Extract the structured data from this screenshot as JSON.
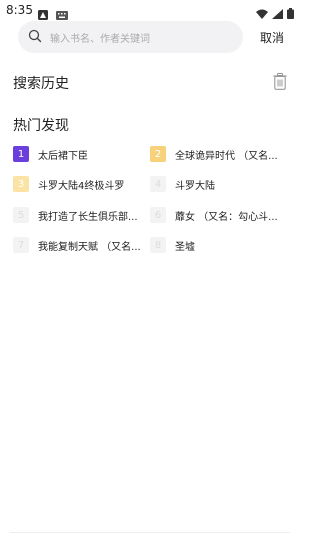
{
  "status_bar": {
    "time": "8:35"
  },
  "search": {
    "placeholder": "输入书名、作者关键词",
    "cancel_label": "取消"
  },
  "history": {
    "title": "搜索历史"
  },
  "hot": {
    "title": "热门发现",
    "items": [
      {
        "rank": "1",
        "title": "太后裙下臣"
      },
      {
        "rank": "2",
        "title": "全球诡异时代 （又名..."
      },
      {
        "rank": "3",
        "title": "斗罗大陆4终极斗罗"
      },
      {
        "rank": "4",
        "title": "斗罗大陆"
      },
      {
        "rank": "5",
        "title": "我打造了长生俱乐部..."
      },
      {
        "rank": "6",
        "title": "蘼女 （又名：勾心斗..."
      },
      {
        "rank": "7",
        "title": "我能复制天赋 （又名..."
      },
      {
        "rank": "8",
        "title": "圣墟"
      }
    ]
  },
  "colors": {
    "rank1": "#6b3fdc",
    "rank2": "#f7d27a",
    "rank3": "#fbe3a6",
    "search_bg": "#f2f2f4"
  }
}
